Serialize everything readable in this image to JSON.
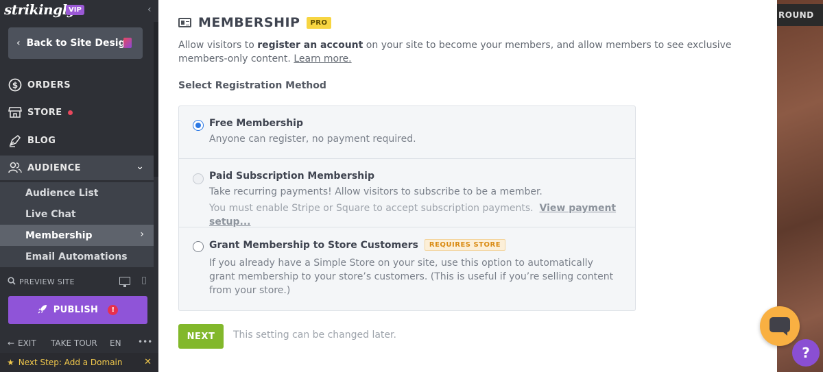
{
  "sidebar": {
    "logo": "strikingly",
    "vip": "VIP",
    "collapse_glyph": "‹",
    "back_label": "Back to Site Design",
    "nav": {
      "orders": "ORDERS",
      "store": "STORE",
      "blog": "BLOG",
      "audience": "AUDIENCE"
    },
    "audience_sub": [
      "Audience List",
      "Live Chat",
      "Membership",
      "Email Automations"
    ],
    "preview": "PREVIEW SITE",
    "publish": "PUBLISH",
    "publish_alert": "!",
    "bottom": {
      "exit": "EXIT",
      "tour": "TAKE TOUR",
      "lang": "EN",
      "more": "•••"
    },
    "next_step": "Next Step: Add a Domain"
  },
  "main": {
    "title": "MEMBERSHIP",
    "pro_badge": "PRO",
    "desc_prefix": "Allow visitors to ",
    "desc_bold": "register an account",
    "desc_suffix": " on your site to become your members, and allow members to see exclusive members-only content. ",
    "learn_more": "Learn more.",
    "section_label": "Select Registration Method",
    "options": [
      {
        "title": "Free Membership",
        "desc": "Anyone can register, no payment required.",
        "selected": true
      },
      {
        "title": "Paid Subscription Membership",
        "desc": "Take recurring payments! Allow visitors to subscribe to be a member.",
        "note": "You must enable Stripe or Square to accept subscription payments.",
        "note_link": "View payment setup...",
        "selected": false,
        "disabled": true
      },
      {
        "title": "Grant Membership to Store Customers",
        "badge": "REQUIRES STORE",
        "desc": "If you already have a Simple Store on your site, use this option to automatically grant membership to your store’s customers. (This is useful if you’re selling content from your store.)",
        "selected": false
      }
    ],
    "next_button": "NEXT",
    "hint": "This setting can be changed later."
  },
  "right": {
    "background_button": "ROUND",
    "help": "?"
  },
  "colors": {
    "sidebar_bg": "#2e3036",
    "publish": "#8f54d8",
    "next_button": "#82b82b",
    "pro_badge": "#f7d541",
    "radio_selected": "#2b78e4",
    "chat": "#f9b042",
    "help": "#8a4fd3"
  },
  "icons": {
    "orders": "dollar-circle-icon",
    "store": "storefront-icon",
    "blog": "pen-nib-icon",
    "audience": "users-icon",
    "preview": "search-icon",
    "publish": "rocket-icon",
    "exit": "arrow-left-icon",
    "next_step": "star-icon",
    "title": "id-card-icon"
  }
}
